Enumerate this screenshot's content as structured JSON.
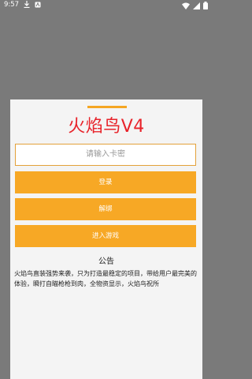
{
  "status_bar": {
    "time": "9:57",
    "icons_left": [
      "download-icon",
      "app-notification-icon"
    ],
    "icons_right": [
      "wifi-icon",
      "signal-icon",
      "battery-icon"
    ]
  },
  "dialog": {
    "title": "火焰鸟V4",
    "card_key_input": {
      "value": "",
      "placeholder": "请输入卡密"
    },
    "buttons": {
      "login": "登录",
      "unbind": "解绑",
      "enter_game": "进入游戏"
    },
    "notice": {
      "title": "公告",
      "body": "火焰鸟直装强势来袭，只为打造最稳定的项目，带给用户最完美的体验，瞬打自瞄枪枪到肉，全物资显示，火焰鸟祝所"
    }
  },
  "colors": {
    "accent": "#f7a825",
    "title_red": "#e8232a",
    "backdrop": "#7a7a7a",
    "card": "#f4f4f4"
  }
}
